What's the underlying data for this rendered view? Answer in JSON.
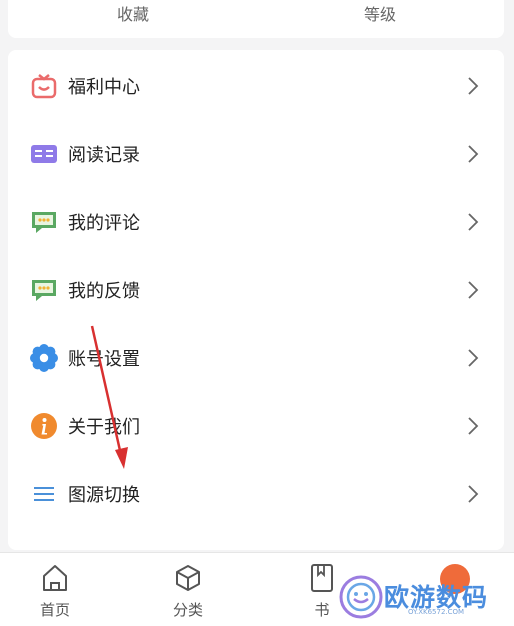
{
  "top": {
    "items": [
      {
        "label": "收藏"
      },
      {
        "label": "等级"
      }
    ]
  },
  "menu": {
    "items": [
      {
        "label": "福利中心",
        "icon": "gift-icon"
      },
      {
        "label": "阅读记录",
        "icon": "book-icon"
      },
      {
        "label": "我的评论",
        "icon": "comment-icon"
      },
      {
        "label": "我的反馈",
        "icon": "feedback-icon"
      },
      {
        "label": "账号设置",
        "icon": "gear-icon"
      },
      {
        "label": "关于我们",
        "icon": "info-icon"
      },
      {
        "label": "图源切换",
        "icon": "list-icon"
      }
    ]
  },
  "tabbar": {
    "items": [
      {
        "label": "首页",
        "icon": "home-icon"
      },
      {
        "label": "分类",
        "icon": "cube-icon"
      },
      {
        "label": "书",
        "icon": "bookshelf-icon"
      }
    ]
  },
  "watermark": {
    "text": "欧游数码",
    "url": "OY.XK6572.COM"
  },
  "colors": {
    "gift": "#ea6b6b",
    "book": "#8f7ae8",
    "comment": "#5aa862",
    "gear": "#3a8ee6",
    "info": "#f08a2e",
    "list": "#4a90d9",
    "arrow": "#d83030"
  }
}
